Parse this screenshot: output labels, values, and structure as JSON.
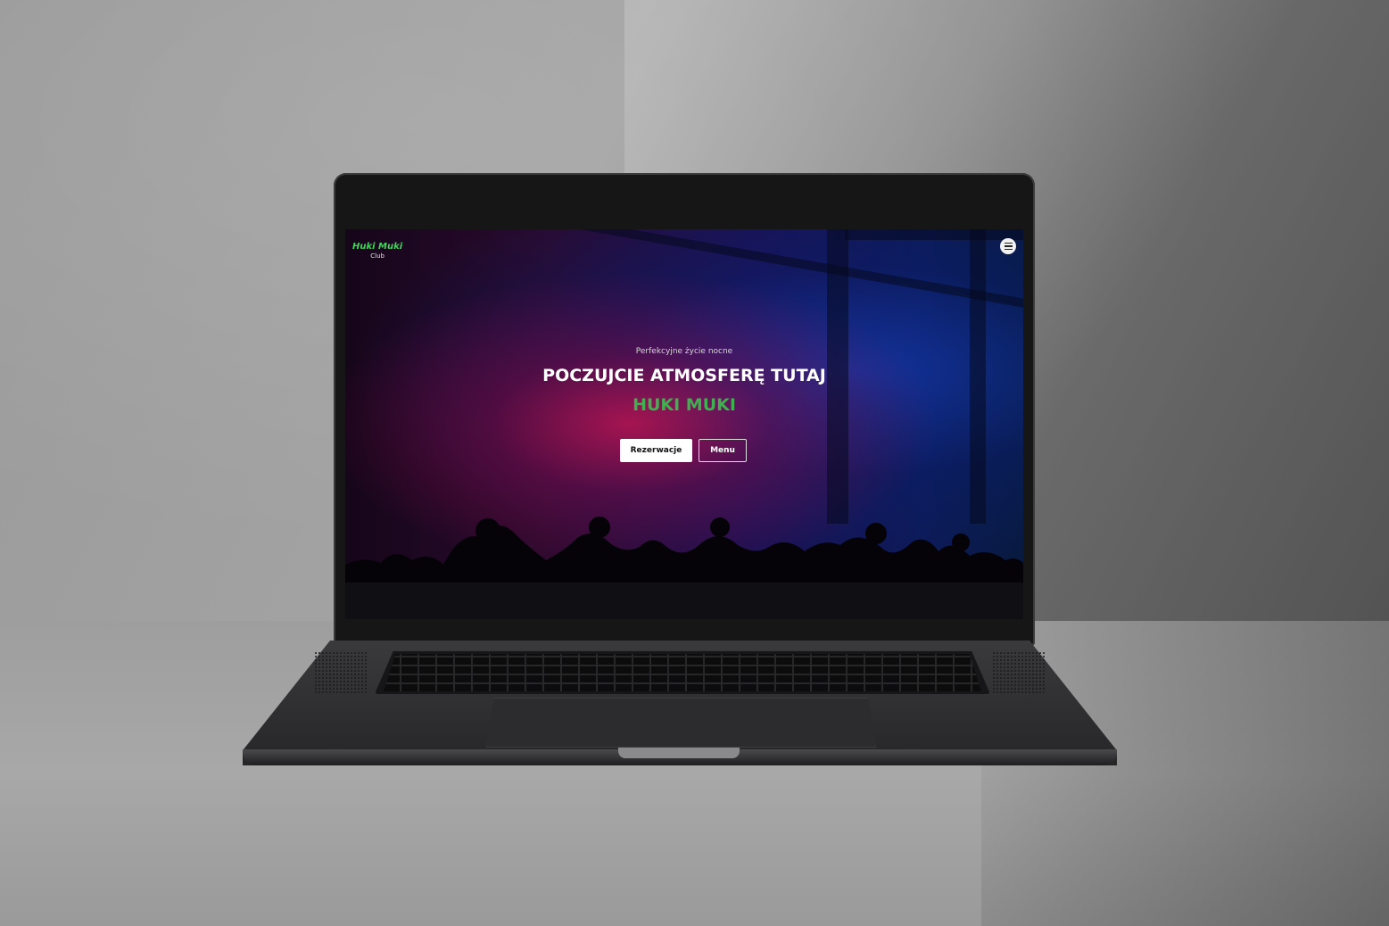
{
  "site": {
    "logo": {
      "name": "Huki Muki",
      "sub": "Club"
    },
    "menu_icon": "hamburger-icon",
    "hero": {
      "tagline": "Perfekcyjne życie nocne",
      "headline": "POCZUJCIE ATMOSFERĘ TUTAJ",
      "brand": "HUKI MUKI",
      "buttons": {
        "primary": "Rezerwacje",
        "secondary": "Menu"
      }
    }
  },
  "colors": {
    "logo_accent": "#41d65a",
    "brand_accent": "#3fb04f",
    "button_primary_bg": "#ffffff",
    "hero_left_glow": "#be1450",
    "hero_right_glow": "#143cb4"
  }
}
